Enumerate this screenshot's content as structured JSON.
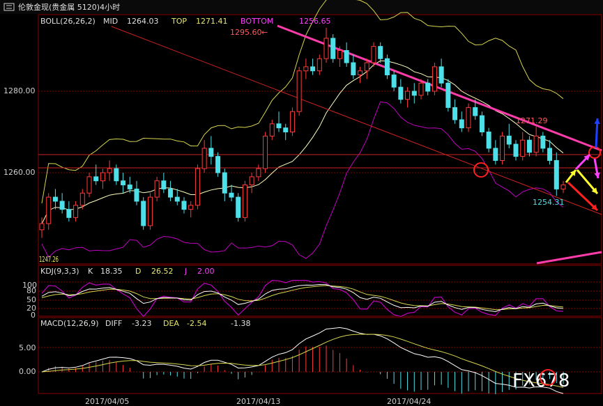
{
  "window": {
    "title": "伦敦金现(贵金属 5120)4小时",
    "watermark": "FX678",
    "dates": [
      "2017/04/05",
      "2017/04/13",
      "2017/04/24"
    ]
  },
  "main": {
    "indicator": "BOLL(26,26,2)",
    "mid_label": "MID",
    "mid_value": "1264.03",
    "top_label": "TOP",
    "top_value": "1271.41",
    "bottom_label": "BOTTOM",
    "bottom_value": "1256.65",
    "y_ticks": [
      "1280.00",
      "1260.00"
    ],
    "annot_high": "1295.60",
    "annot_mid": "1271.29",
    "annot_low": "1254.31",
    "annot_start": "1247.26"
  },
  "kdj": {
    "indicator": "KDJ(9,3,3)",
    "k_label": "K",
    "k_value": "18.35",
    "d_label": "D",
    "d_value": "26.52",
    "j_label": "J",
    "j_value": "2.00",
    "y_ticks": [
      "100",
      "80",
      "50",
      "20",
      "0"
    ]
  },
  "macd": {
    "indicator": "MACD(12,26,9)",
    "diff_label": "DIFF",
    "diff_value": "-3.23",
    "dea_label": "DEA",
    "dea_value": "-2.54",
    "hist_value": "-1.38",
    "y_ticks": [
      "5.00",
      "0.00"
    ]
  },
  "colors": {
    "up": "#ff3b3b",
    "down": "#4ee0e8",
    "bg": "#000000",
    "grid": "#7a0000",
    "boll_mid": "#ffffc0",
    "boll_top": "#d6d64e",
    "boll_bot": "#c000c0",
    "trend": "#ff3cab",
    "text_yellow": "#e8e870",
    "text_red": "#ff5a5a",
    "text_cyan": "#4ee0e8",
    "text_magenta": "#ff40ff"
  },
  "chart_data": {
    "type": "candlestick",
    "title": "伦敦金现(贵金属 5120)4小时",
    "x_labels": [
      "2017/04/05",
      "2017/04/13",
      "2017/04/24"
    ],
    "y_ticks": [
      1280.0,
      1260.0
    ],
    "ylim": [
      1242,
      1300
    ],
    "candles": [
      {
        "o": 1246,
        "h": 1249,
        "l": 1244,
        "c": 1247.5
      },
      {
        "o": 1247.5,
        "h": 1255,
        "l": 1246,
        "c": 1254
      },
      {
        "o": 1254,
        "h": 1256,
        "l": 1251,
        "c": 1253
      },
      {
        "o": 1253,
        "h": 1255,
        "l": 1250,
        "c": 1251
      },
      {
        "o": 1251,
        "h": 1253,
        "l": 1248,
        "c": 1249
      },
      {
        "o": 1249,
        "h": 1253,
        "l": 1248,
        "c": 1252
      },
      {
        "o": 1252,
        "h": 1256,
        "l": 1251,
        "c": 1255
      },
      {
        "o": 1255,
        "h": 1260,
        "l": 1254,
        "c": 1259
      },
      {
        "o": 1259,
        "h": 1262,
        "l": 1257,
        "c": 1258
      },
      {
        "o": 1258,
        "h": 1261,
        "l": 1256,
        "c": 1260
      },
      {
        "o": 1260,
        "h": 1263,
        "l": 1258,
        "c": 1261
      },
      {
        "o": 1261,
        "h": 1262,
        "l": 1257,
        "c": 1258
      },
      {
        "o": 1258,
        "h": 1260,
        "l": 1255,
        "c": 1257
      },
      {
        "o": 1257,
        "h": 1259,
        "l": 1255,
        "c": 1256
      },
      {
        "o": 1256,
        "h": 1258,
        "l": 1252,
        "c": 1253
      },
      {
        "o": 1253,
        "h": 1254,
        "l": 1246,
        "c": 1247
      },
      {
        "o": 1247,
        "h": 1255,
        "l": 1246,
        "c": 1254
      },
      {
        "o": 1254,
        "h": 1259,
        "l": 1253,
        "c": 1258
      },
      {
        "o": 1258,
        "h": 1260,
        "l": 1255,
        "c": 1256
      },
      {
        "o": 1256,
        "h": 1258,
        "l": 1253,
        "c": 1254
      },
      {
        "o": 1254,
        "h": 1256,
        "l": 1252,
        "c": 1253
      },
      {
        "o": 1253,
        "h": 1254,
        "l": 1250,
        "c": 1251
      },
      {
        "o": 1251,
        "h": 1253,
        "l": 1249,
        "c": 1252
      },
      {
        "o": 1252,
        "h": 1262,
        "l": 1251,
        "c": 1261
      },
      {
        "o": 1261,
        "h": 1268,
        "l": 1260,
        "c": 1266
      },
      {
        "o": 1266,
        "h": 1269,
        "l": 1262,
        "c": 1264
      },
      {
        "o": 1264,
        "h": 1265,
        "l": 1259,
        "c": 1260
      },
      {
        "o": 1260,
        "h": 1261,
        "l": 1253,
        "c": 1255
      },
      {
        "o": 1255,
        "h": 1257,
        "l": 1253,
        "c": 1254
      },
      {
        "o": 1254,
        "h": 1255,
        "l": 1248,
        "c": 1249
      },
      {
        "o": 1249,
        "h": 1258,
        "l": 1248,
        "c": 1257
      },
      {
        "o": 1257,
        "h": 1260,
        "l": 1255,
        "c": 1259
      },
      {
        "o": 1259,
        "h": 1262,
        "l": 1258,
        "c": 1261
      },
      {
        "o": 1261,
        "h": 1270,
        "l": 1260,
        "c": 1269
      },
      {
        "o": 1269,
        "h": 1273,
        "l": 1268,
        "c": 1272
      },
      {
        "o": 1272,
        "h": 1275,
        "l": 1270,
        "c": 1271
      },
      {
        "o": 1271,
        "h": 1272,
        "l": 1268,
        "c": 1270
      },
      {
        "o": 1270,
        "h": 1276,
        "l": 1269,
        "c": 1275
      },
      {
        "o": 1275,
        "h": 1286,
        "l": 1274,
        "c": 1285
      },
      {
        "o": 1285,
        "h": 1288,
        "l": 1283,
        "c": 1286
      },
      {
        "o": 1286,
        "h": 1288,
        "l": 1284,
        "c": 1285
      },
      {
        "o": 1285,
        "h": 1289,
        "l": 1284,
        "c": 1288
      },
      {
        "o": 1288,
        "h": 1295.6,
        "l": 1287,
        "c": 1293
      },
      {
        "o": 1293,
        "h": 1294,
        "l": 1287,
        "c": 1288
      },
      {
        "o": 1288,
        "h": 1291,
        "l": 1286,
        "c": 1290
      },
      {
        "o": 1290,
        "h": 1292,
        "l": 1286,
        "c": 1287
      },
      {
        "o": 1287,
        "h": 1289,
        "l": 1283,
        "c": 1284
      },
      {
        "o": 1284,
        "h": 1286,
        "l": 1282,
        "c": 1285
      },
      {
        "o": 1285,
        "h": 1288,
        "l": 1283,
        "c": 1287
      },
      {
        "o": 1287,
        "h": 1292,
        "l": 1286,
        "c": 1291
      },
      {
        "o": 1291,
        "h": 1292,
        "l": 1287,
        "c": 1288
      },
      {
        "o": 1288,
        "h": 1289,
        "l": 1283,
        "c": 1284
      },
      {
        "o": 1284,
        "h": 1285,
        "l": 1280,
        "c": 1281
      },
      {
        "o": 1281,
        "h": 1283,
        "l": 1277,
        "c": 1278
      },
      {
        "o": 1278,
        "h": 1281,
        "l": 1276,
        "c": 1280
      },
      {
        "o": 1280,
        "h": 1282,
        "l": 1277,
        "c": 1279
      },
      {
        "o": 1279,
        "h": 1283,
        "l": 1278,
        "c": 1282
      },
      {
        "o": 1282,
        "h": 1283,
        "l": 1279,
        "c": 1280
      },
      {
        "o": 1280,
        "h": 1287,
        "l": 1279,
        "c": 1286
      },
      {
        "o": 1286,
        "h": 1288,
        "l": 1281,
        "c": 1282
      },
      {
        "o": 1282,
        "h": 1283,
        "l": 1275,
        "c": 1276
      },
      {
        "o": 1276,
        "h": 1278,
        "l": 1272,
        "c": 1273
      },
      {
        "o": 1273,
        "h": 1275,
        "l": 1270,
        "c": 1271
      },
      {
        "o": 1271,
        "h": 1277,
        "l": 1270,
        "c": 1276
      },
      {
        "o": 1276,
        "h": 1278,
        "l": 1273,
        "c": 1274
      },
      {
        "o": 1274,
        "h": 1275,
        "l": 1269,
        "c": 1270
      },
      {
        "o": 1270,
        "h": 1271,
        "l": 1265,
        "c": 1266
      },
      {
        "o": 1266,
        "h": 1268,
        "l": 1262,
        "c": 1263
      },
      {
        "o": 1263,
        "h": 1270,
        "l": 1262,
        "c": 1269
      },
      {
        "o": 1269,
        "h": 1272,
        "l": 1266,
        "c": 1267
      },
      {
        "o": 1267,
        "h": 1268,
        "l": 1263,
        "c": 1264
      },
      {
        "o": 1264,
        "h": 1270,
        "l": 1263,
        "c": 1268
      },
      {
        "o": 1268,
        "h": 1269,
        "l": 1264,
        "c": 1265
      },
      {
        "o": 1265,
        "h": 1271.29,
        "l": 1264,
        "c": 1269
      },
      {
        "o": 1269,
        "h": 1270,
        "l": 1265,
        "c": 1266
      },
      {
        "o": 1266,
        "h": 1268,
        "l": 1262,
        "c": 1263
      },
      {
        "o": 1263,
        "h": 1265,
        "l": 1254.31,
        "c": 1256
      },
      {
        "o": 1256,
        "h": 1258,
        "l": 1255,
        "c": 1257
      }
    ],
    "kdj_range": [
      0,
      100
    ],
    "macd_range": [
      -4,
      8
    ]
  }
}
